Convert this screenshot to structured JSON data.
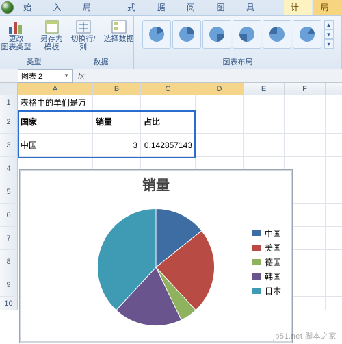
{
  "ribbon": {
    "tabs": [
      "开始",
      "插入",
      "页面布局",
      "公式",
      "数据",
      "审阅",
      "视图",
      "开发工具"
    ],
    "ctx_tabs": [
      "设计",
      "布局"
    ],
    "active_ctx": 0,
    "groups": {
      "type": {
        "label": "类型",
        "btn_change": "更改\n图表类型",
        "btn_saveas": "另存为\n模板"
      },
      "data": {
        "label": "数据",
        "btn_switch": "切换行/列",
        "btn_select": "选择数据"
      },
      "layout": {
        "label": "图表布局"
      }
    }
  },
  "namebox": "图表 2",
  "grid": {
    "cols": [
      "A",
      "B",
      "C",
      "D",
      "E",
      "F"
    ],
    "note": "表格中的单们是万",
    "headers": {
      "country": "国家",
      "sales": "销量",
      "ratio": "占比"
    },
    "row3": {
      "country": "中国",
      "sales": "3",
      "ratio": "0.142857143"
    }
  },
  "chart_data": {
    "type": "pie",
    "title": "销量",
    "series": [
      {
        "name": "中国",
        "value": 3,
        "ratio": 0.1429,
        "color": "#3e6da4"
      },
      {
        "name": "美国",
        "value": 5,
        "ratio": 0.2381,
        "color": "#b84c45"
      },
      {
        "name": "德国",
        "value": 1,
        "ratio": 0.0476,
        "color": "#8fb25e"
      },
      {
        "name": "韩国",
        "value": 4,
        "ratio": 0.1905,
        "color": "#6a548e"
      },
      {
        "name": "日本",
        "value": 8,
        "ratio": 0.381,
        "color": "#3e9bb3"
      }
    ],
    "legend_position": "right"
  },
  "watermark": "jb51.net  脚本之家"
}
